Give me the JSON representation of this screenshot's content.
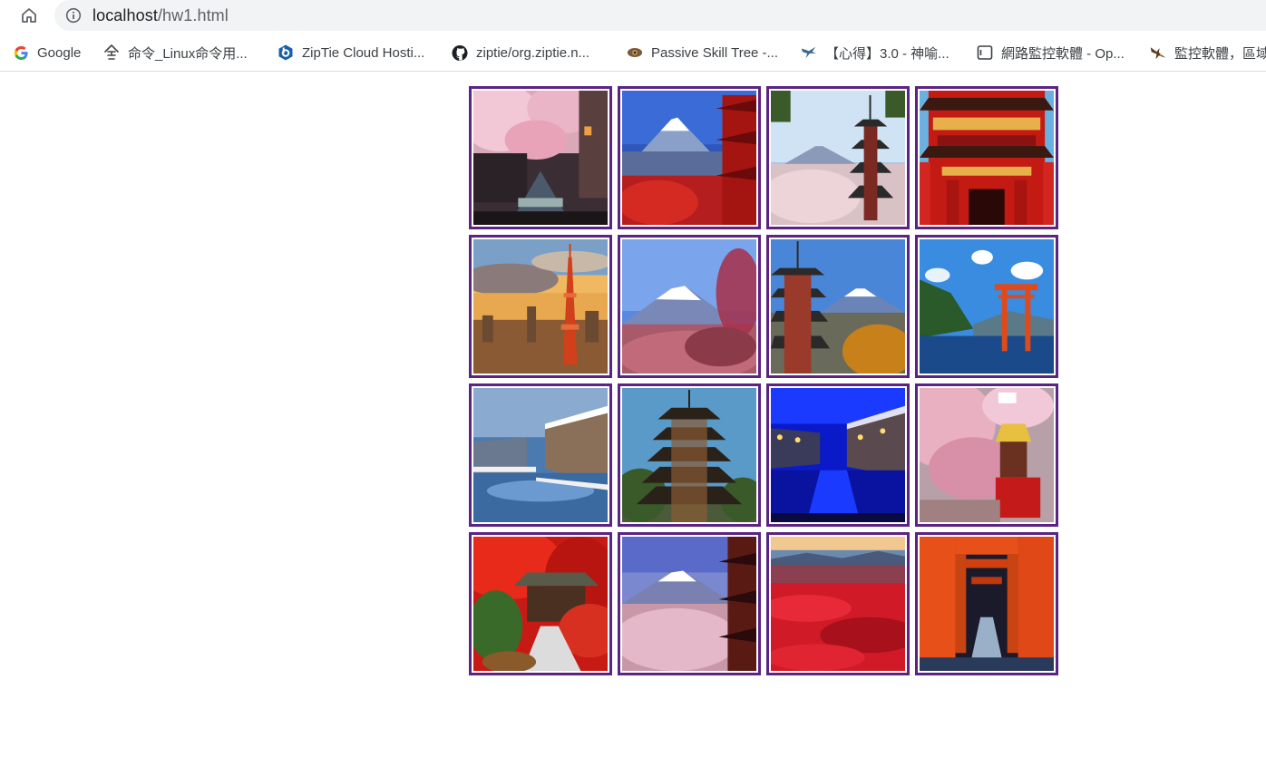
{
  "browser": {
    "url_host": "localhost",
    "url_path": "/hw1.html"
  },
  "bookmarks": [
    {
      "label": "Google",
      "icon": "google-icon"
    },
    {
      "label": "命令_Linux命令用...",
      "icon": "linux-command-icon"
    },
    {
      "label": "ZipTie Cloud Hosti...",
      "icon": "ziptie-icon"
    },
    {
      "label": "ziptie/org.ziptie.n...",
      "icon": "github-icon"
    },
    {
      "label": "Passive Skill Tree -...",
      "icon": "passive-skill-icon"
    },
    {
      "label": "【心得】3.0 - 神喻...",
      "icon": "bird-icon"
    },
    {
      "label": "網路監控軟體 - Op...",
      "icon": "window-icon"
    },
    {
      "label": "監控軟體，區域",
      "icon": "eagle-icon"
    }
  ],
  "gallery": {
    "border_color": "#5b2483",
    "images": [
      {
        "subject": "cherry-blossom-canal"
      },
      {
        "subject": "mount-fuji-pagoda"
      },
      {
        "subject": "chureito-pagoda-fuji"
      },
      {
        "subject": "red-temple-gate"
      },
      {
        "subject": "tokyo-tower-sunset"
      },
      {
        "subject": "mount-fuji-plum-blossom"
      },
      {
        "subject": "pagoda-fuji-autumn"
      },
      {
        "subject": "itsukushima-torii"
      },
      {
        "subject": "otaru-canal-snow"
      },
      {
        "subject": "five-story-pagoda"
      },
      {
        "subject": "otaru-canal-night"
      },
      {
        "subject": "cherry-blossom-festival-float"
      },
      {
        "subject": "autumn-maple-pavilion"
      },
      {
        "subject": "mount-fuji-cherry-pagoda"
      },
      {
        "subject": "red-flower-field"
      },
      {
        "subject": "fushimi-inari-torii-path"
      }
    ]
  }
}
